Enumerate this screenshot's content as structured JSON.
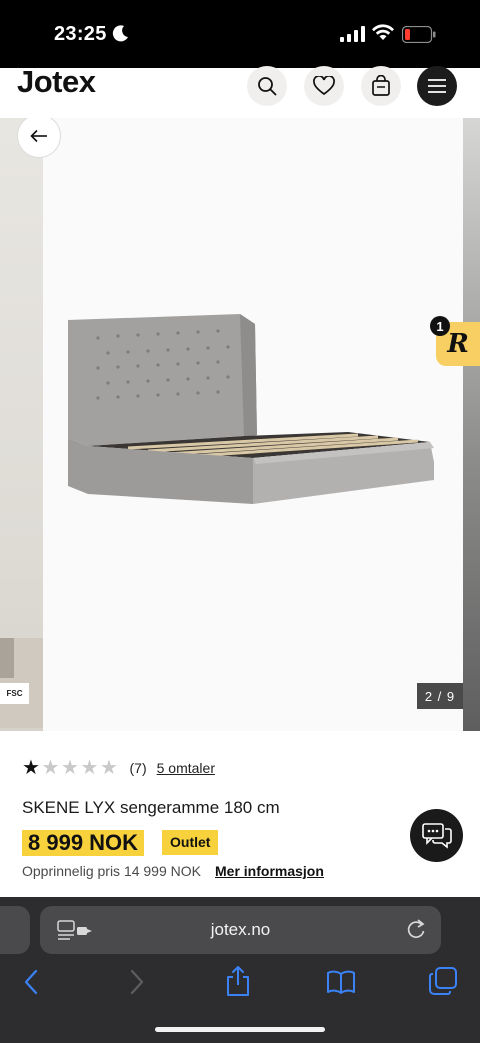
{
  "status_bar": {
    "time": "23:25",
    "icons": [
      "moon-icon",
      "signal-icon",
      "wifi-icon",
      "battery-low-icon"
    ],
    "battery_color": "#ff3b30"
  },
  "header": {
    "logo": "Jotex",
    "icons": [
      "search-icon",
      "heart-icon",
      "shopping-bag-icon",
      "menu-icon"
    ]
  },
  "gallery": {
    "fsc_badge": "FSC",
    "counter": "2 / 9",
    "back_icon": "arrow-left-icon",
    "image": "upholstered-bed-frame"
  },
  "reviews_widget": {
    "count": "1",
    "letter": "R",
    "color": "#f7cf63"
  },
  "product": {
    "rating": 1,
    "max_rating": 5,
    "rating_count": "(7)",
    "reviews_link": "5 omtaler",
    "title": "SKENE LYX sengeramme 180 cm",
    "price": "8 999 NOK",
    "badge": "Outlet",
    "original_price": "Opprinnelig pris 14 999 NOK",
    "more_info": "Mer informasjon",
    "accent_color": "#f7d23c"
  },
  "browser": {
    "url": "jotex.no",
    "toolbar": [
      "back-icon",
      "forward-icon",
      "share-icon",
      "bookmarks-icon",
      "tabs-icon"
    ],
    "accent_color": "#3b82f6"
  }
}
